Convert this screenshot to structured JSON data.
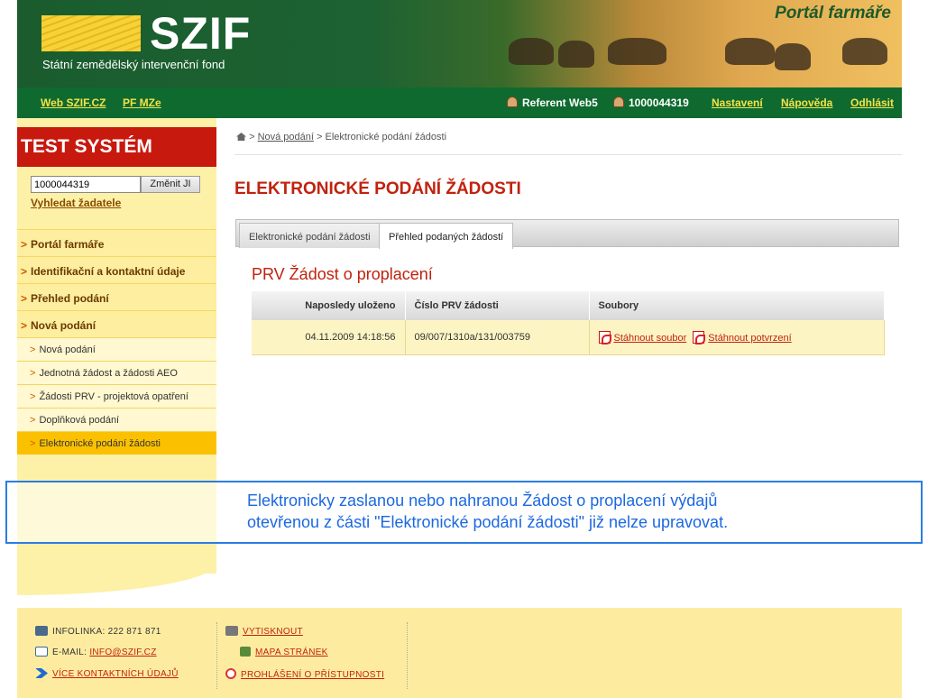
{
  "header": {
    "logo_text": "SZIF",
    "logo_subtitle": "Státní zemědělský intervenční fond",
    "portal_title": "Portál farmáře"
  },
  "nav": {
    "left_links": [
      "Web SZIF.CZ",
      "PF MZe"
    ],
    "user_role": "Referent Web5",
    "user_id": "1000044319",
    "right_links": [
      "Nastavení",
      "Nápověda",
      "Odhlásit"
    ]
  },
  "sidebar": {
    "system_label": "TEST SYSTÉM",
    "ji_value": "1000044319",
    "ji_button": "Změnit JI",
    "search_link": "Vyhledat žadatele",
    "menu": [
      "Portál farmáře",
      "Identifikační a kontaktní údaje",
      "Přehled podání",
      "Nová podání"
    ],
    "submenu": [
      "Nová podání",
      "Jednotná žádost a žádosti AEO",
      "Žádosti PRV - projektová opatření",
      "Doplňková podání",
      "Elektronické podání žádosti"
    ],
    "arrow": ">"
  },
  "breadcrumb": {
    "sep": ">",
    "link": "Nová podání",
    "current": "Elektronické podání žádosti"
  },
  "main": {
    "title": "ELEKTRONICKÉ PODÁNÍ ŽÁDOSTI",
    "tabs": [
      "Elektronické podání žádosti",
      "Přehled podaných žádostí"
    ],
    "section_title": "PRV Žádost o proplacení",
    "table": {
      "headers": [
        "Naposledy uloženo",
        "Číslo PRV žádosti",
        "Soubory"
      ],
      "rows": [
        {
          "saved": "04.11.2009 14:18:56",
          "number": "09/007/1310a/131/003759",
          "files": [
            "Stáhnout soubor",
            "Stáhnout potvrzení"
          ]
        }
      ]
    }
  },
  "notice": {
    "line1": "Elektronicky zaslanou nebo nahranou Žádost o proplacení výdajů",
    "line2": "otevřenou z části \"Elektronické podání žádosti\" již nelze upravovat."
  },
  "footer": {
    "infolinka_label": "INFOLINKA: 222 871 871",
    "email_label": "E-MAIL:",
    "email_link": "INFO@SZIF.CZ",
    "contacts_link": "VÍCE KONTAKTNÍCH ÚDAJŮ",
    "print_link": "VYTISKNOUT",
    "sitemap_link": "MAPA STRÁNEK",
    "accessibility_link": "PROHLÁŠENÍ O PŘÍSTUPNOSTI"
  }
}
